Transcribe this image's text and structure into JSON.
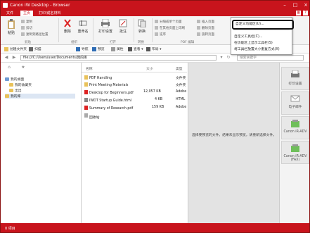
{
  "window": {
    "title": "Canon iW Desktop - Browser"
  },
  "menu": {
    "tabs": [
      "文件",
      "主页",
      "打印/成名材料"
    ],
    "active_tab": "主页"
  },
  "ribbon": {
    "paste": "粘贴",
    "copy": "复制",
    "cut": "剪切",
    "copy_path": "复制到路径位置",
    "clipboard_group": "剪贴",
    "delete": "删除",
    "rename": "重命名",
    "organize_group": "组织",
    "print": "打印设置",
    "annotate": "批注",
    "open_group": "打开",
    "convert": "转换",
    "convert_group": "转换",
    "pdf_items": [
      "分隔成单个页面",
      "在其他页面上印刷",
      "逆序"
    ],
    "pdf_items2": [
      "插入页面",
      "删除页面",
      "旋转页面"
    ],
    "pdf_group": "PDF 编辑",
    "pdf_items3": [
      "提取页面",
      "打印页面"
    ]
  },
  "toolbar": {
    "new_folder": "创建文件夹",
    "scan": "扫描",
    "nav": "导航",
    "preview": "预览",
    "thumbnail": "属性",
    "view": "查看",
    "layout": "布局"
  },
  "address": {
    "path": "file:///C:/Users/user/Documents/我的库",
    "search_placeholder": "搜索关键字"
  },
  "tree": {
    "items": [
      "我的桌面",
      "我的收藏夹",
      "出出",
      "我的库"
    ]
  },
  "list": {
    "columns": [
      "名称",
      "大小",
      "类型"
    ],
    "rows": [
      {
        "name": "PDF Handling",
        "size": "",
        "type": "文件夹"
      },
      {
        "name": "Print Meeting Materials",
        "size": "",
        "type": "文件夹"
      },
      {
        "name": "Desktop for Beginners.pdf",
        "size": "12,057 KB",
        "type": "Adobe"
      },
      {
        "name": "IWDT Startup Guide.html",
        "size": "4 KB",
        "type": "HTML"
      },
      {
        "name": "Summary of Research.pdf",
        "size": "159 KB",
        "type": "Adobe"
      },
      {
        "name": "回收站",
        "size": "",
        "type": ""
      }
    ]
  },
  "preview": {
    "message": "选择要预览的文件。结果未显示预览，请重新选择文件。"
  },
  "side_buttons": [
    "打印设置",
    "电子邮件",
    "Canon iR-ADV",
    "Canon iR-ADV (FAX)"
  ],
  "dropdown": {
    "items": [
      "自定义功能区(U)...",
      "自定义工具栏(C)...",
      "在功能区上显示工具栏(S)",
      "将工具栏放置大小重复方式(X)"
    ]
  },
  "status": {
    "text": "0 项目"
  },
  "colors": {
    "brand": "#c8141c"
  }
}
